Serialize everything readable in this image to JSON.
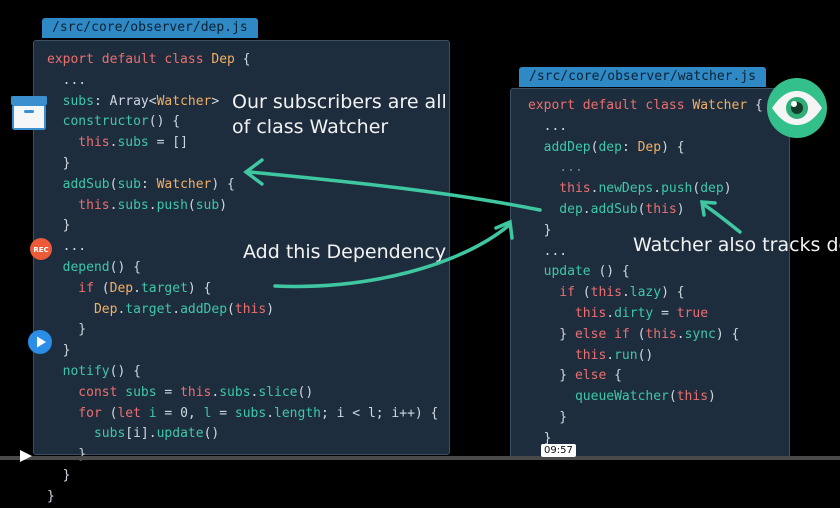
{
  "left_panel": {
    "path": "/src/core/observer/dep.js",
    "lines": [
      [
        [
          "kw",
          "export default class "
        ],
        [
          "cls",
          "Dep"
        ],
        [
          "id",
          " {"
        ]
      ],
      [
        [
          "id",
          "  ..."
        ]
      ],
      [
        [
          "fn",
          "  subs"
        ],
        [
          "id",
          ": Array<"
        ],
        [
          "ty",
          "Watcher"
        ],
        [
          "id",
          ">"
        ]
      ],
      [
        [
          "fn",
          "  constructor"
        ],
        [
          "id",
          "() {"
        ]
      ],
      [
        [
          "kw",
          "    this"
        ],
        [
          "id",
          "."
        ],
        [
          "fn",
          "subs"
        ],
        [
          "id",
          " = []"
        ]
      ],
      [
        [
          "id",
          "  }"
        ]
      ],
      [
        [
          "fn",
          "  addSub"
        ],
        [
          "id",
          "("
        ],
        [
          "fn",
          "sub"
        ],
        [
          "id",
          ": "
        ],
        [
          "ty",
          "Watcher"
        ],
        [
          "id",
          ") {"
        ]
      ],
      [
        [
          "kw",
          "    this"
        ],
        [
          "id",
          "."
        ],
        [
          "fn",
          "subs"
        ],
        [
          "id",
          "."
        ],
        [
          "fn",
          "push"
        ],
        [
          "id",
          "("
        ],
        [
          "fn",
          "sub"
        ],
        [
          "id",
          ")"
        ]
      ],
      [
        [
          "id",
          "  }"
        ]
      ],
      [
        [
          "id",
          "  ..."
        ]
      ],
      [
        [
          "fn",
          "  depend"
        ],
        [
          "id",
          "() {"
        ]
      ],
      [
        [
          "kw",
          "    if"
        ],
        [
          "id",
          " ("
        ],
        [
          "ty",
          "Dep"
        ],
        [
          "id",
          "."
        ],
        [
          "fn",
          "target"
        ],
        [
          "id",
          ") {"
        ]
      ],
      [
        [
          "ty",
          "      Dep"
        ],
        [
          "id",
          "."
        ],
        [
          "fn",
          "target"
        ],
        [
          "id",
          "."
        ],
        [
          "fn",
          "addDep"
        ],
        [
          "id",
          "("
        ],
        [
          "kw",
          "this"
        ],
        [
          "id",
          ")"
        ]
      ],
      [
        [
          "id",
          "    }"
        ]
      ],
      [
        [
          "id",
          "  }"
        ]
      ],
      [
        [
          "fn",
          "  notify"
        ],
        [
          "id",
          "() {"
        ]
      ],
      [
        [
          "kw",
          "    const "
        ],
        [
          "fn",
          "subs"
        ],
        [
          "id",
          " = "
        ],
        [
          "kw",
          "this"
        ],
        [
          "id",
          "."
        ],
        [
          "fn",
          "subs"
        ],
        [
          "id",
          "."
        ],
        [
          "fn",
          "slice"
        ],
        [
          "id",
          "()"
        ]
      ],
      [
        [
          "kw",
          "    for"
        ],
        [
          "id",
          " ("
        ],
        [
          "kw",
          "let "
        ],
        [
          "fn",
          "i"
        ],
        [
          "id",
          " = 0, "
        ],
        [
          "fn",
          "l"
        ],
        [
          "id",
          " = "
        ],
        [
          "fn",
          "subs"
        ],
        [
          "id",
          "."
        ],
        [
          "fn",
          "length"
        ],
        [
          "id",
          "; i < l; i++) {"
        ]
      ],
      [
        [
          "fn",
          "      subs"
        ],
        [
          "id",
          "[i]."
        ],
        [
          "fn",
          "update"
        ],
        [
          "id",
          "()"
        ]
      ],
      [
        [
          "id",
          "    }"
        ]
      ],
      [
        [
          "id",
          "  }"
        ]
      ],
      [
        [
          "id",
          "}"
        ]
      ]
    ]
  },
  "right_panel": {
    "path": "/src/core/observer/watcher.js",
    "lines": [
      [
        [
          "kw",
          "export default class "
        ],
        [
          "cls",
          "Watcher"
        ],
        [
          "id",
          " {"
        ]
      ],
      [
        [
          "id",
          "  ..."
        ]
      ],
      [
        [
          "fn",
          "  addDep"
        ],
        [
          "id",
          "("
        ],
        [
          "fn",
          "dep"
        ],
        [
          "id",
          ": "
        ],
        [
          "ty",
          "Dep"
        ],
        [
          "id",
          ") {"
        ]
      ],
      [
        [
          "cm",
          "    ..."
        ]
      ],
      [
        [
          "kw",
          "    this"
        ],
        [
          "id",
          "."
        ],
        [
          "fn",
          "newDeps"
        ],
        [
          "id",
          "."
        ],
        [
          "fn",
          "push"
        ],
        [
          "id",
          "("
        ],
        [
          "fn",
          "dep"
        ],
        [
          "id",
          ")"
        ]
      ],
      [
        [
          "fn",
          "    dep"
        ],
        [
          "id",
          "."
        ],
        [
          "fn",
          "addSub"
        ],
        [
          "id",
          "("
        ],
        [
          "kw",
          "this"
        ],
        [
          "id",
          ")"
        ]
      ],
      [
        [
          "id",
          "  }"
        ]
      ],
      [
        [
          "id",
          "  ..."
        ]
      ],
      [
        [
          "fn",
          "  update"
        ],
        [
          "id",
          " () {"
        ]
      ],
      [
        [
          "kw",
          "    if"
        ],
        [
          "id",
          " ("
        ],
        [
          "kw",
          "this"
        ],
        [
          "id",
          "."
        ],
        [
          "fn",
          "lazy"
        ],
        [
          "id",
          ") {"
        ]
      ],
      [
        [
          "kw",
          "      this"
        ],
        [
          "id",
          "."
        ],
        [
          "fn",
          "dirty"
        ],
        [
          "id",
          " = "
        ],
        [
          "kw",
          "true"
        ]
      ],
      [
        [
          "id",
          "    } "
        ],
        [
          "kw",
          "else if"
        ],
        [
          "id",
          " ("
        ],
        [
          "kw",
          "this"
        ],
        [
          "id",
          "."
        ],
        [
          "fn",
          "sync"
        ],
        [
          "id",
          ") {"
        ]
      ],
      [
        [
          "kw",
          "      this"
        ],
        [
          "id",
          "."
        ],
        [
          "fn",
          "run"
        ],
        [
          "id",
          "()"
        ]
      ],
      [
        [
          "id",
          "    } "
        ],
        [
          "kw",
          "else"
        ],
        [
          "id",
          " {"
        ]
      ],
      [
        [
          "fn",
          "      queueWatcher"
        ],
        [
          "id",
          "("
        ],
        [
          "kw",
          "this"
        ],
        [
          "id",
          ")"
        ]
      ],
      [
        [
          "id",
          "    }"
        ]
      ],
      [
        [
          "id",
          "  }"
        ]
      ]
    ]
  },
  "annotations": {
    "subscribers": "Our subscribers are all\nof class Watcher",
    "add_dependency": "Add this Dependency",
    "watcher_tracks": "Watcher also tracks de"
  },
  "video": {
    "time": "09:57",
    "rec_label": "REC"
  },
  "colors": {
    "background": "#000000",
    "panel": "#1e2d3d",
    "tab": "#2f89c5",
    "arrow": "#3ec7a0"
  }
}
